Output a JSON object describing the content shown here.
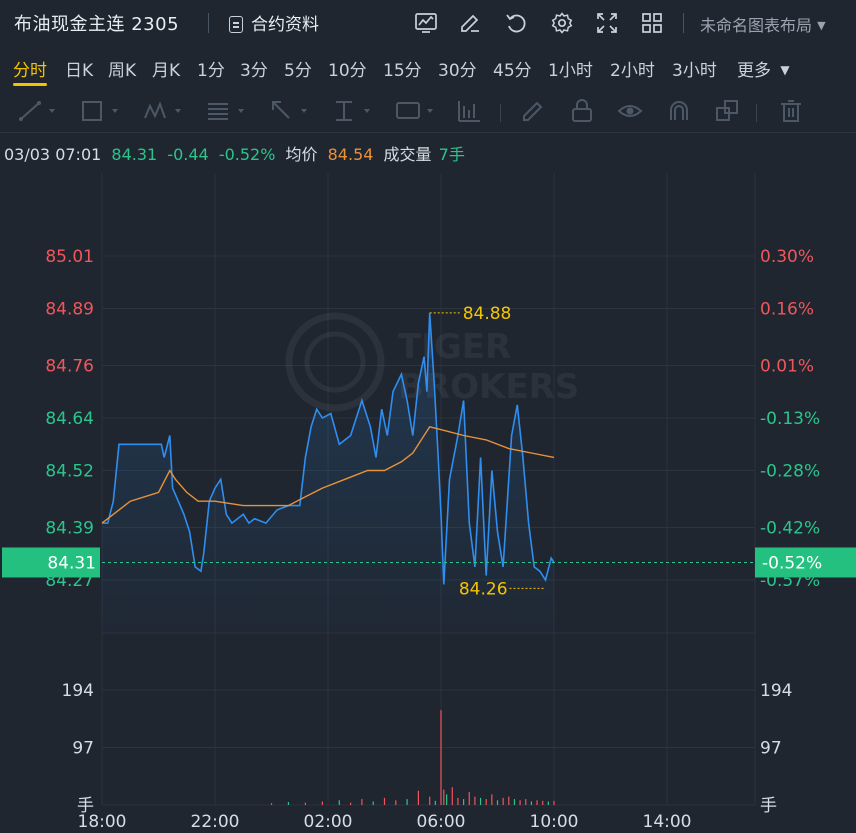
{
  "header": {
    "instrument": "布油现金主连 2305",
    "contract_info_label": "合约资料",
    "layout_label": "未命名图表布局",
    "toolbar_icons": [
      "chart-icon",
      "edit-icon",
      "refresh-icon",
      "settings-icon",
      "fullscreen-icon",
      "grid-icon"
    ]
  },
  "tabs": [
    "分时",
    "日K",
    "周K",
    "月K",
    "1分",
    "3分",
    "5分",
    "10分",
    "15分",
    "30分",
    "45分",
    "1小时",
    "2小时",
    "3小时",
    "更多"
  ],
  "active_tab": "分时",
  "drawing_tools": [
    "line-tool-icon",
    "rectangle-tool-icon",
    "pattern-tool-icon",
    "fib-tool-icon",
    "arrow-tool-icon",
    "measure-tool-icon",
    "text-tool-icon",
    "indicator-tool-icon",
    "brush-icon",
    "lock-icon",
    "eye-icon",
    "magnet-icon",
    "layers-icon",
    "trash-icon"
  ],
  "info": {
    "datetime": "03/03 07:01",
    "price": "84.31",
    "change": "-0.44",
    "change_pct": "-0.52%",
    "avg_label": "均价",
    "avg_value": "84.54",
    "volume_label": "成交量",
    "volume_value": "7手"
  },
  "colors": {
    "up": "#f0565b",
    "down": "#2bc58c",
    "price_line": "#2f8ef0",
    "avg_line": "#e8923a",
    "highlight": "#f5c400"
  },
  "chart_data": {
    "type": "line",
    "price_ticks_left": [
      "85.01",
      "84.89",
      "84.76",
      "84.64",
      "84.52",
      "84.39",
      "84.27"
    ],
    "price_tick_values": [
      85.01,
      84.89,
      84.76,
      84.64,
      84.52,
      84.39,
      84.27
    ],
    "pct_ticks_right": [
      "0.30%",
      "0.16%",
      "0.01%",
      "-0.13%",
      "-0.28%",
      "-0.42%",
      "-0.57%"
    ],
    "current_price_label": "84.31",
    "current_pct_label": "-0.52%",
    "high_label": "84.88",
    "low_label": "84.26",
    "ylim": [
      84.27,
      85.01
    ],
    "x_labels": [
      "18:00",
      "22:00",
      "02:00",
      "06:00",
      "10:00",
      "14:00"
    ],
    "volume_ticks": [
      "194",
      "97",
      "手"
    ],
    "volume_tick_values": [
      194,
      97,
      0
    ],
    "price_series": [
      [
        0,
        84.4
      ],
      [
        0.1,
        84.4
      ],
      [
        0.2,
        84.45
      ],
      [
        0.3,
        84.58
      ],
      [
        0.5,
        84.58
      ],
      [
        0.8,
        84.58
      ],
      [
        1.05,
        84.58
      ],
      [
        1.1,
        84.55
      ],
      [
        1.2,
        84.6
      ],
      [
        1.25,
        84.48
      ],
      [
        1.35,
        84.45
      ],
      [
        1.45,
        84.42
      ],
      [
        1.55,
        84.38
      ],
      [
        1.65,
        84.3
      ],
      [
        1.75,
        84.29
      ],
      [
        1.8,
        84.33
      ],
      [
        1.9,
        84.45
      ],
      [
        2.0,
        84.48
      ],
      [
        2.1,
        84.5
      ],
      [
        2.2,
        84.42
      ],
      [
        2.3,
        84.4
      ],
      [
        2.5,
        84.42
      ],
      [
        2.6,
        84.4
      ],
      [
        2.7,
        84.41
      ],
      [
        2.9,
        84.4
      ],
      [
        3.1,
        84.43
      ],
      [
        3.3,
        84.44
      ],
      [
        3.5,
        84.44
      ],
      [
        3.6,
        84.55
      ],
      [
        3.7,
        84.62
      ],
      [
        3.8,
        84.66
      ],
      [
        3.9,
        84.64
      ],
      [
        4.05,
        84.65
      ],
      [
        4.2,
        84.58
      ],
      [
        4.4,
        84.6
      ],
      [
        4.6,
        84.68
      ],
      [
        4.75,
        84.62
      ],
      [
        4.85,
        84.55
      ],
      [
        4.95,
        84.66
      ],
      [
        5.05,
        84.6
      ],
      [
        5.15,
        84.7
      ],
      [
        5.3,
        84.74
      ],
      [
        5.4,
        84.68
      ],
      [
        5.5,
        84.6
      ],
      [
        5.6,
        84.72
      ],
      [
        5.7,
        84.78
      ],
      [
        5.75,
        84.7
      ],
      [
        5.8,
        84.88
      ],
      [
        5.88,
        84.72
      ],
      [
        5.95,
        84.55
      ],
      [
        6.0,
        84.42
      ],
      [
        6.05,
        84.26
      ],
      [
        6.15,
        84.5
      ],
      [
        6.3,
        84.6
      ],
      [
        6.4,
        84.68
      ],
      [
        6.5,
        84.4
      ],
      [
        6.6,
        84.3
      ],
      [
        6.7,
        84.55
      ],
      [
        6.8,
        84.28
      ],
      [
        6.9,
        84.52
      ],
      [
        7.0,
        84.38
      ],
      [
        7.1,
        84.3
      ],
      [
        7.25,
        84.6
      ],
      [
        7.35,
        84.67
      ],
      [
        7.45,
        84.55
      ],
      [
        7.55,
        84.4
      ],
      [
        7.65,
        84.3
      ],
      [
        7.75,
        84.29
      ],
      [
        7.85,
        84.27
      ],
      [
        7.95,
        84.32
      ],
      [
        8.0,
        84.31
      ]
    ],
    "avg_series": [
      [
        0,
        84.4
      ],
      [
        0.1,
        84.41
      ],
      [
        0.5,
        84.45
      ],
      [
        1.0,
        84.47
      ],
      [
        1.2,
        84.52
      ],
      [
        1.3,
        84.5
      ],
      [
        1.5,
        84.47
      ],
      [
        1.7,
        84.45
      ],
      [
        2.0,
        84.45
      ],
      [
        2.5,
        84.44
      ],
      [
        3.0,
        84.44
      ],
      [
        3.3,
        84.44
      ],
      [
        3.6,
        84.46
      ],
      [
        3.9,
        84.48
      ],
      [
        4.3,
        84.5
      ],
      [
        4.7,
        84.52
      ],
      [
        5.0,
        84.52
      ],
      [
        5.3,
        84.54
      ],
      [
        5.5,
        84.56
      ],
      [
        5.8,
        84.62
      ],
      [
        6.1,
        84.61
      ],
      [
        6.4,
        84.6
      ],
      [
        6.8,
        84.59
      ],
      [
        7.2,
        84.57
      ],
      [
        7.6,
        84.56
      ],
      [
        8.0,
        84.55
      ]
    ],
    "volume_series": [
      [
        3.0,
        3
      ],
      [
        3.3,
        5
      ],
      [
        3.6,
        4
      ],
      [
        3.9,
        6
      ],
      [
        4.2,
        8
      ],
      [
        4.4,
        4
      ],
      [
        4.6,
        10
      ],
      [
        4.8,
        6
      ],
      [
        5.0,
        12
      ],
      [
        5.2,
        8
      ],
      [
        5.4,
        10
      ],
      [
        5.6,
        24
      ],
      [
        5.8,
        14
      ],
      [
        5.9,
        7
      ],
      [
        6.0,
        160
      ],
      [
        6.05,
        26
      ],
      [
        6.1,
        18
      ],
      [
        6.2,
        30
      ],
      [
        6.3,
        12
      ],
      [
        6.4,
        10
      ],
      [
        6.5,
        22
      ],
      [
        6.6,
        14
      ],
      [
        6.7,
        12
      ],
      [
        6.8,
        10
      ],
      [
        6.9,
        18
      ],
      [
        7.0,
        8
      ],
      [
        7.1,
        12
      ],
      [
        7.2,
        14
      ],
      [
        7.3,
        10
      ],
      [
        7.4,
        8
      ],
      [
        7.5,
        10
      ],
      [
        7.6,
        6
      ],
      [
        7.7,
        8
      ],
      [
        7.8,
        7
      ],
      [
        7.9,
        6
      ],
      [
        8.0,
        7
      ]
    ]
  }
}
